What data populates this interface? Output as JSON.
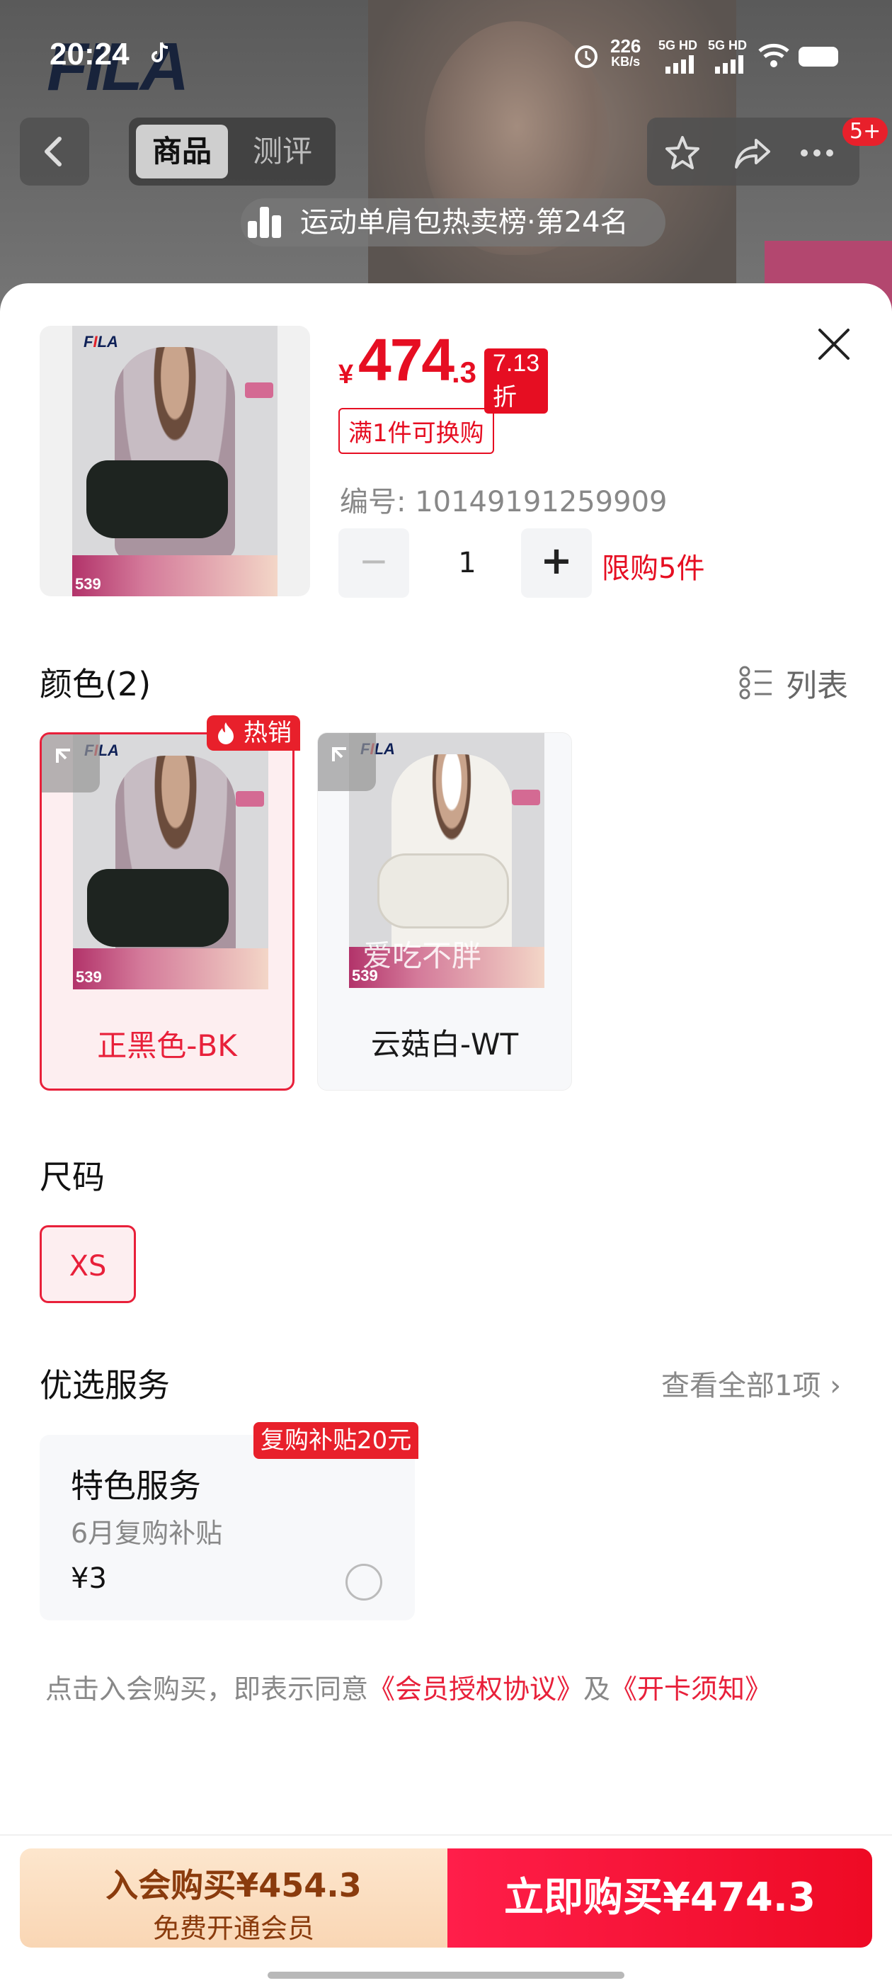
{
  "status_bar": {
    "time": "20:24",
    "speed_value": "226",
    "speed_unit": "KB/s",
    "signal1": "5G HD",
    "signal2": "5G HD"
  },
  "background": {
    "brand_logo": "FILA",
    "tabs": [
      {
        "label": "商品"
      },
      {
        "label": "测评"
      }
    ],
    "cart_badge": "5+",
    "rank_text": "运动单肩包热卖榜·第24名"
  },
  "product": {
    "currency": "¥",
    "price_int": "474",
    "price_dec": ".3",
    "discount": "7.13折",
    "exchange_tag": "满1件可换购",
    "code": "编号: 10149191259909",
    "quantity": "1",
    "limit": "限购5件",
    "thumb_price": "539"
  },
  "color_section": {
    "title": "颜色(2)",
    "list_label": "列表",
    "options": [
      {
        "label": "正黑色-BK",
        "selected": true,
        "image_price": "539"
      },
      {
        "label": "云菇白-WT",
        "selected": false,
        "image_price": "539"
      }
    ],
    "hot_tag": "热销",
    "watermark": "爱吃不胖"
  },
  "size_section": {
    "title": "尺码",
    "options": [
      {
        "label": "XS",
        "selected": true
      }
    ]
  },
  "service_section": {
    "title": "优选服务",
    "view_all": "查看全部1项 ›",
    "card": {
      "tag": "复购补贴20元",
      "name": "特色服务",
      "subtitle": "6月复购补贴",
      "price": "¥3",
      "selected": false
    }
  },
  "agreement": {
    "prefix": "点击入会购买，即表示同意",
    "link1": "《会员授权协议》",
    "mid": "及",
    "link2": "《开卡须知》"
  },
  "bottom_bar": {
    "member_line1": "入会购买¥454.3",
    "member_line2": "免费开通会员",
    "buy_now": "立即购买¥474.3"
  },
  "colors": {
    "accent_red": "#e60e22",
    "member_bg": "#fde6cd",
    "member_text": "#8a3b0d"
  }
}
